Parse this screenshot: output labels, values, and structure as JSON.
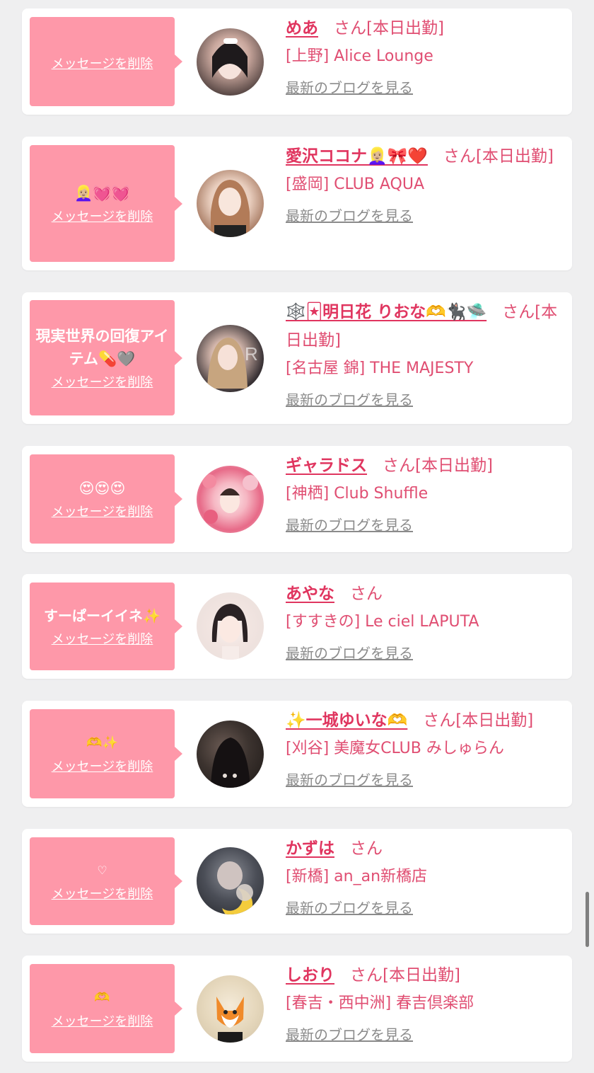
{
  "common": {
    "delete_label": "メッセージを削除",
    "blog_label": "最新のブログを見る",
    "san_label": "さん"
  },
  "colors": {
    "bubble": "#fe98a9",
    "name": "#e0355f",
    "text": "#e04e72",
    "blog_link": "#8b8b8b",
    "background": "#efeff0"
  },
  "items": [
    {
      "message": "",
      "name": "めあ",
      "status": "[本日出勤]",
      "shop": "[上野] Alice Lounge",
      "avatar_icon": "avatar-photo-icon"
    },
    {
      "message": "👱🏼‍♀️💓💓",
      "name": "愛沢ココナ👱🏼‍♀️🎀❤️",
      "status": "[本日出勤]",
      "shop": "[盛岡] CLUB AQUA",
      "avatar_icon": "avatar-photo-icon"
    },
    {
      "message": "現実世界の回復アイテム💊🩶",
      "name": "🕸️🃏明日花 りおな🫶🐈‍⬛🛸",
      "status": "[本日出勤]",
      "shop": "[名古屋 錦] THE MAJESTY",
      "avatar_icon": "avatar-photo-icon"
    },
    {
      "message": "😍😍😍",
      "name": "ギャラドス",
      "status": "[本日出勤]",
      "shop": "[神栖] Club Shuffle",
      "avatar_icon": "avatar-photo-icon"
    },
    {
      "message": "すーぱーイイネ✨",
      "name": "あやな",
      "status": "",
      "shop": "[すすきの] Le ciel LAPUTA",
      "avatar_icon": "avatar-photo-icon"
    },
    {
      "message": "🫶✨",
      "name": "✨一城ゆいな🫶",
      "status": "[本日出勤]",
      "shop": "[刈谷] 美魔女CLUB みしゅらん",
      "avatar_icon": "avatar-photo-icon"
    },
    {
      "message": "♡",
      "name": "かずは",
      "status": "",
      "shop": "[新橋] an_an新橋店",
      "avatar_icon": "avatar-photo-icon"
    },
    {
      "message": "🫶",
      "name": "しおり",
      "status": "[本日出勤]",
      "shop": "[春吉・西中洲] 春吉倶楽部",
      "avatar_icon": "avatar-photo-icon"
    }
  ]
}
